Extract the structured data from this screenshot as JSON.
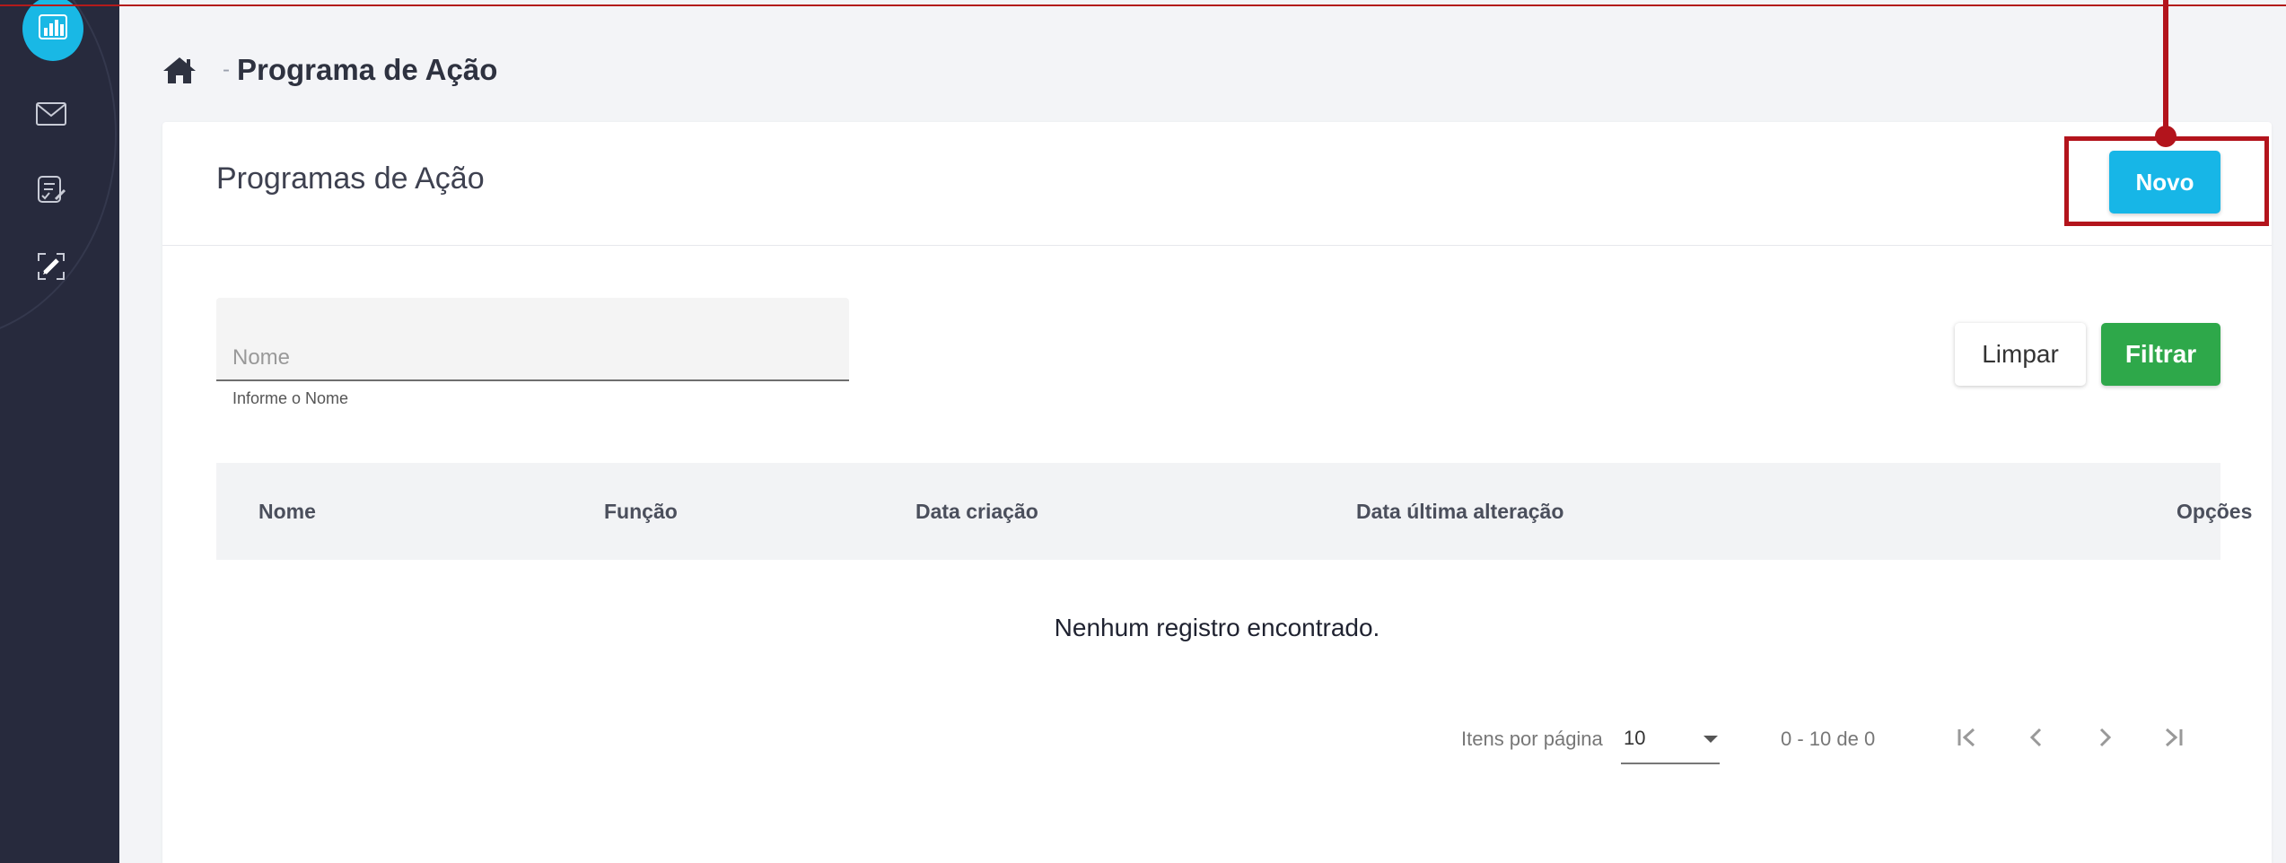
{
  "breadcrumb": {
    "title": "Programa de Ação",
    "separator": "-"
  },
  "card": {
    "title": "Programas de Ação"
  },
  "buttons": {
    "new": "Novo",
    "clear": "Limpar",
    "filter": "Filtrar"
  },
  "filter": {
    "name_placeholder": "Nome",
    "name_hint": "Informe o Nome",
    "name_value": ""
  },
  "table": {
    "columns": [
      "Nome",
      "Função",
      "Data criação",
      "Data última alteração",
      "Opções"
    ],
    "rows": [],
    "empty_message": "Nenhum registro encontrado."
  },
  "pagination": {
    "items_per_page_label": "Itens por página",
    "items_per_page": "10",
    "range": "0 - 10 de 0"
  },
  "colors": {
    "sidebar": "#272a3d",
    "accent": "#17b6e7",
    "success": "#2ea84a",
    "annotation": "#b3141c"
  }
}
